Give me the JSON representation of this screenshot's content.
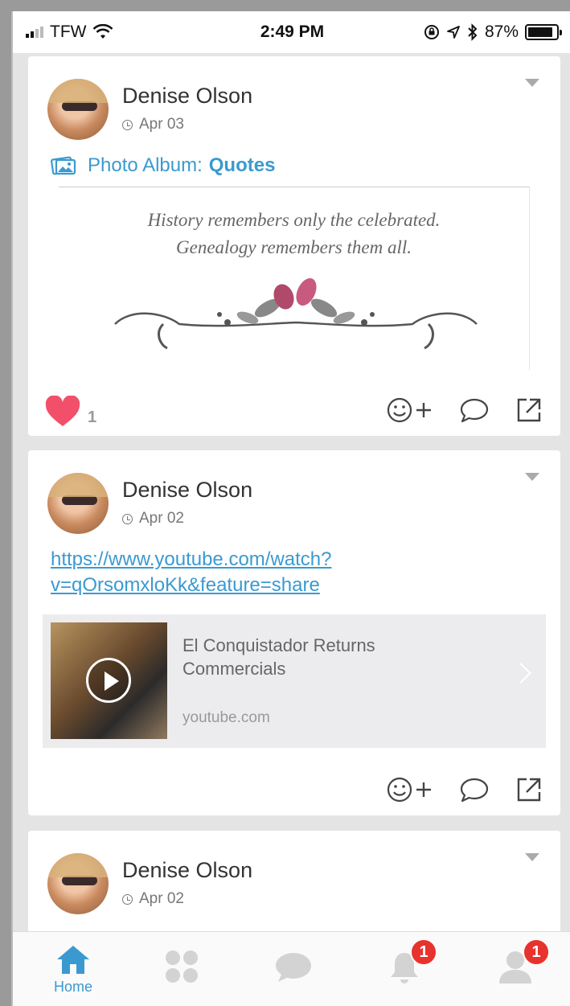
{
  "status_bar": {
    "carrier": "TFW",
    "time": "2:49 PM",
    "battery_percent": "87%",
    "battery_level": 0.87,
    "icons": [
      "signal-icon",
      "wifi-icon",
      "orientation-lock-icon",
      "location-icon",
      "bluetooth-icon",
      "battery-icon"
    ]
  },
  "posts": [
    {
      "author": "Denise Olson",
      "date": "Apr 03",
      "album_prefix": "Photo Album:",
      "album_name": "Quotes",
      "quote_line1": "History remembers only the celebrated.",
      "quote_line2": "Genealogy remembers them all.",
      "like_count": "1"
    },
    {
      "author": "Denise Olson",
      "date": "Apr 02",
      "link_line1": "https://www.youtube.com/watch?",
      "link_line2": "v=qOrsomxloKk&feature=share",
      "preview_title": "El Conquistador Returns Commercials",
      "preview_domain": "youtube.com"
    },
    {
      "author": "Denise Olson",
      "date": "Apr 02"
    }
  ],
  "tabbar": {
    "home_label": "Home",
    "notifications_badge": "1",
    "profile_badge": "1"
  },
  "colors": {
    "accent": "#3a9ad0",
    "like": "#f2506a",
    "badge": "#e8322d"
  }
}
